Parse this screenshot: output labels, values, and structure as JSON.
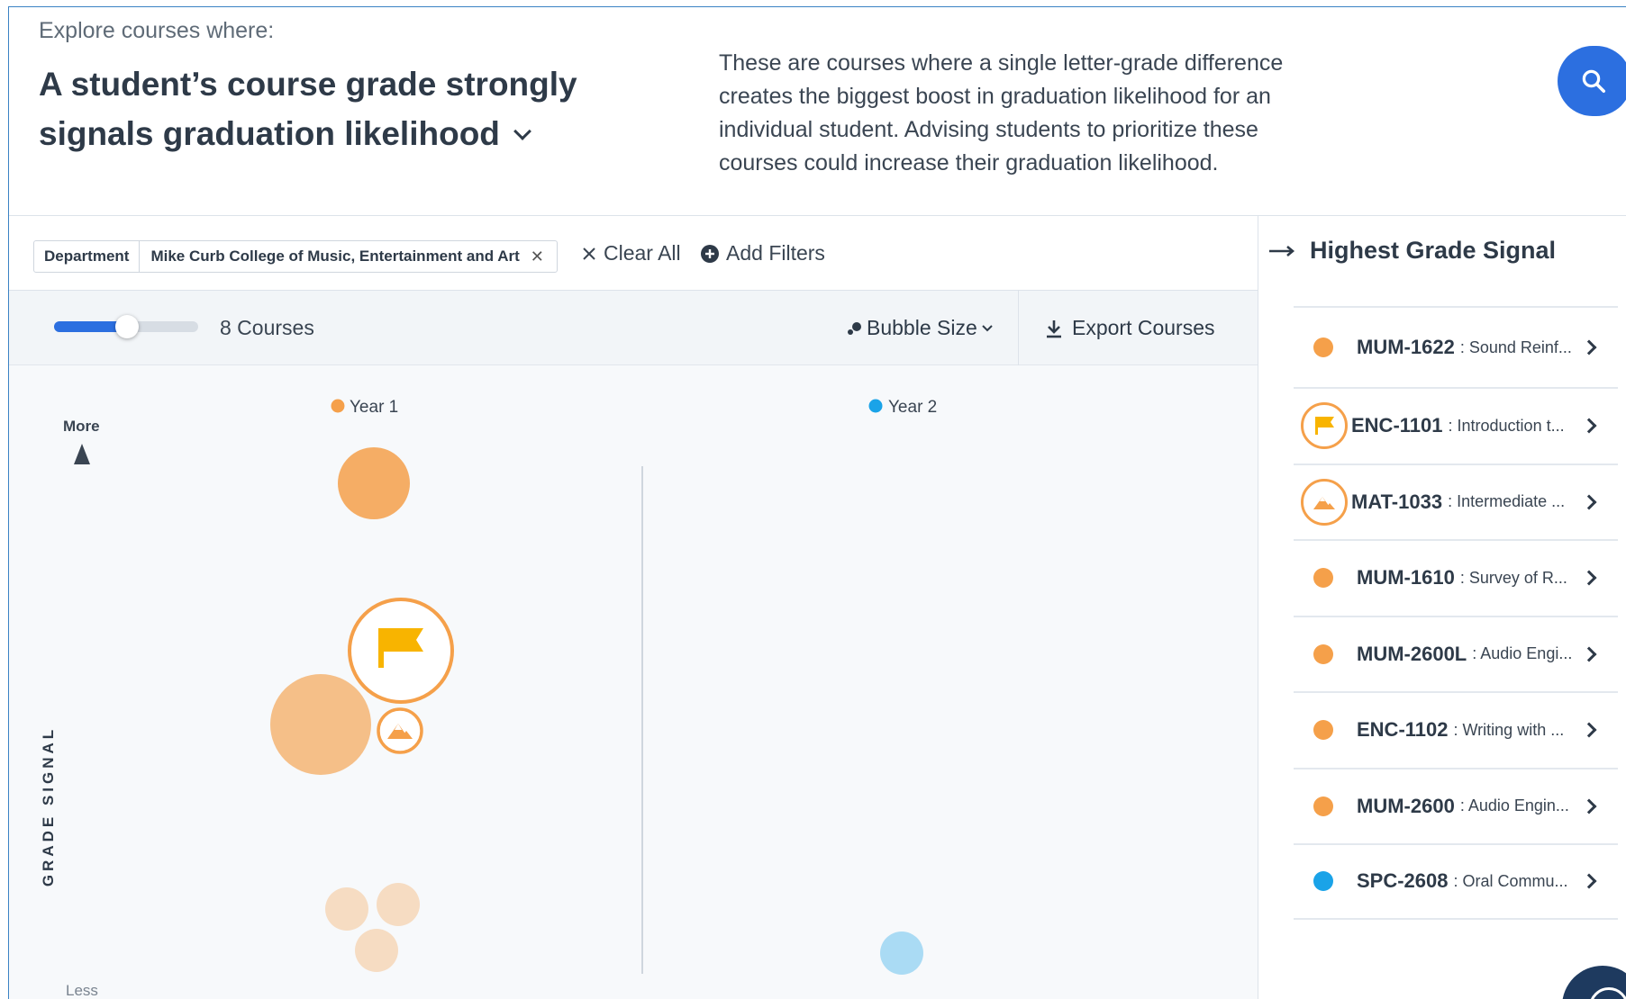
{
  "header": {
    "kicker": "Explore courses where:",
    "title": "A student’s course grade strongly signals graduation likelihood",
    "description": "These are courses where a single letter-grade difference creates the biggest boost in graduation likelihood for an individual student. Advising students to prioritize these courses could increase their graduation likelihood."
  },
  "filters": {
    "chip_key": "Department",
    "chip_value": "Mike Curb College of Music, Entertainment and Art",
    "clear_label": "Clear All",
    "add_label": "Add Filters"
  },
  "toolbar": {
    "course_count": "8 Courses",
    "bubble_size_label": "Bubble Size",
    "export_label": "Export Courses"
  },
  "chart_data": {
    "type": "scatter",
    "y_axis_label": "GRADE SIGNAL",
    "y_top_label": "More",
    "y_bottom_label": "Less",
    "groups": [
      {
        "name": "Year 1",
        "color": "#f5a04a"
      },
      {
        "name": "Year 2",
        "color": "#1aa3e8"
      }
    ]
  },
  "panel": {
    "title": "Highest Grade Signal",
    "courses": [
      {
        "code": "MUM-1622",
        "name": ": Sound Reinf...",
        "color": "#f5a04a",
        "icon": "dot"
      },
      {
        "code": "ENC-1101",
        "name": ": Introduction t...",
        "color": "#f5a04a",
        "icon": "flag-icon"
      },
      {
        "code": "MAT-1033",
        "name": ": Intermediate ...",
        "color": "#f5a04a",
        "icon": "mountain-icon"
      },
      {
        "code": "MUM-1610",
        "name": ": Survey of R...",
        "color": "#f5a04a",
        "icon": "dot"
      },
      {
        "code": "MUM-2600L",
        "name": ": Audio Engi...",
        "color": "#f5a04a",
        "icon": "dot"
      },
      {
        "code": "ENC-1102",
        "name": ": Writing with ...",
        "color": "#f5a04a",
        "icon": "dot"
      },
      {
        "code": "MUM-2600",
        "name": ": Audio Engin...",
        "color": "#f5a04a",
        "icon": "dot"
      },
      {
        "code": "SPC-2608",
        "name": ": Oral Commu...",
        "color": "#1aa3e8",
        "icon": "dot"
      }
    ]
  }
}
